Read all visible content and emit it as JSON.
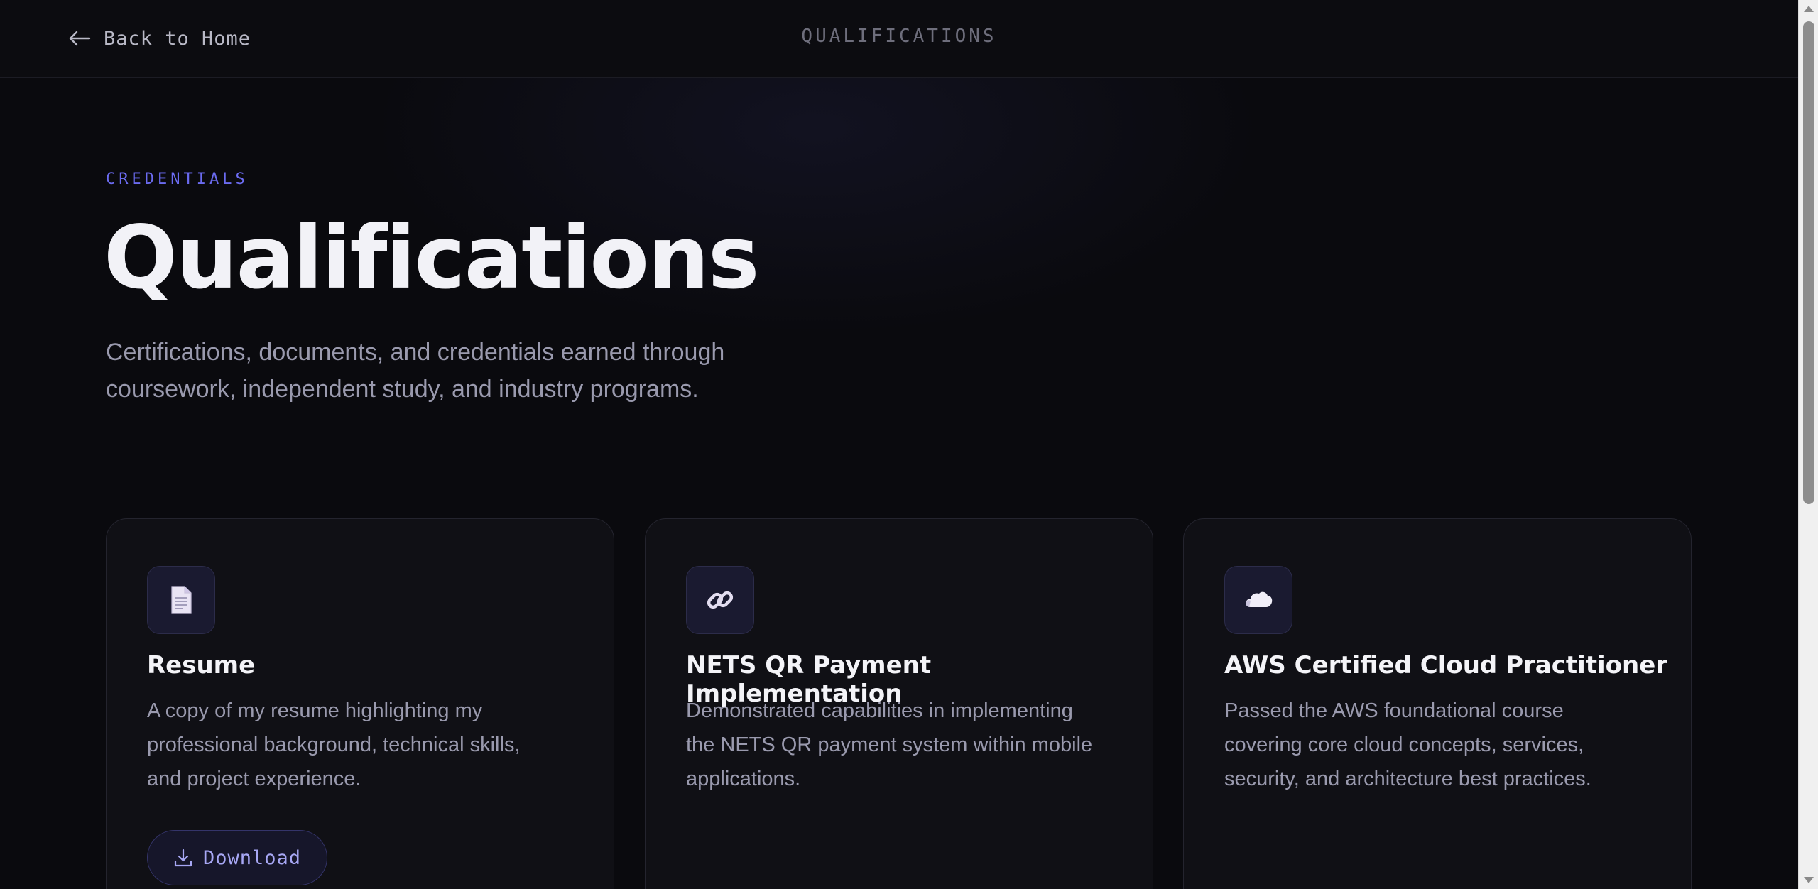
{
  "header": {
    "back_label": "Back to Home",
    "title": "QUALIFICATIONS"
  },
  "hero": {
    "eyebrow": "CREDENTIALS",
    "title": "Qualifications",
    "subtitle_line1": "Certifications, documents, and credentials earned through",
    "subtitle_line2": "coursework, independent study, and industry programs."
  },
  "cards": [
    {
      "icon": "document-icon",
      "title": "Resume",
      "desc_lines": [
        "A copy of my resume highlighting my",
        "professional background, technical skills,",
        "and project experience."
      ],
      "button_label": "Download"
    },
    {
      "icon": "link-icon",
      "title": "NETS QR Payment Implementation",
      "desc_lines": [
        "Demonstrated capabilities in implementing",
        "the NETS QR payment system within mobile",
        "applications."
      ]
    },
    {
      "icon": "cloud-icon",
      "title": "AWS Certified Cloud Practitioner",
      "desc_lines": [
        "Passed the AWS foundational course",
        "covering core cloud concepts, services,",
        "security, and architecture best practices."
      ]
    }
  ],
  "colors": {
    "background": "#0a0a0e",
    "accent": "#6b6bf0",
    "card_bg": "#101015",
    "text_primary": "#f2f2f7",
    "text_muted": "#9a9aae"
  }
}
